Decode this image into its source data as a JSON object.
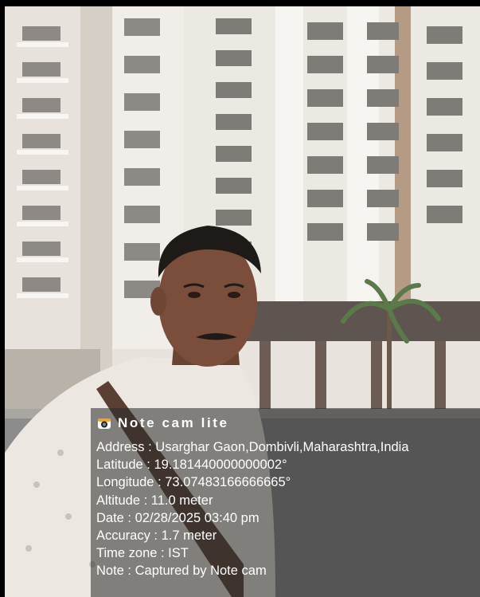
{
  "app": {
    "name": "Note cam lite",
    "icon": "camera-icon"
  },
  "stamp": {
    "lines": [
      "Address : Usarghar Gaon,Dombivli,Maharashtra,India",
      "Latitude : 19.181440000000002°",
      "Longitude : 73.07483166666665°",
      "Altitude : 11.0 meter",
      "Date : 02/28/2025 03:40 pm",
      "Accuracy : 1.7 meter",
      "Time zone : IST",
      "Note : Captured by Note cam"
    ]
  },
  "colors": {
    "overlay": "#282828",
    "text": "#ffffff",
    "icon_accent": "#f2a32c"
  }
}
